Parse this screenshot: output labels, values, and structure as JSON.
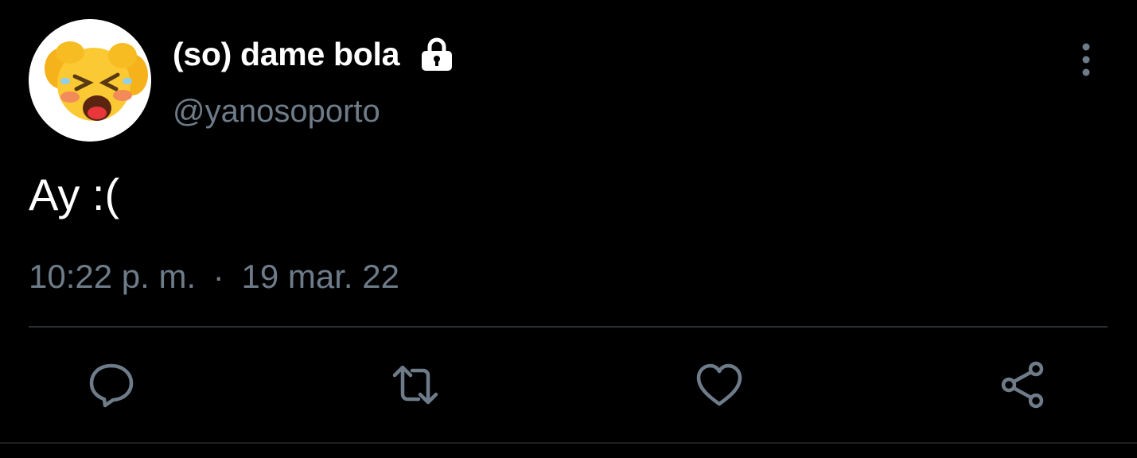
{
  "tweet": {
    "display_name": "(so) dame bola",
    "handle": "@yanosoporto",
    "text": "Ay :(",
    "time": "10:22 p. m.",
    "separator": "·",
    "date": "19 mar. 22",
    "protected": true
  },
  "icons": {
    "lock": "lock-icon",
    "more": "more-vertical-icon",
    "reply": "reply-icon",
    "retweet": "retweet-icon",
    "like": "heart-icon",
    "share": "share-icon"
  },
  "colors": {
    "background": "#000000",
    "primary_text": "#ffffff",
    "secondary_text": "#6e7c89",
    "divider": "#2a2f33"
  }
}
